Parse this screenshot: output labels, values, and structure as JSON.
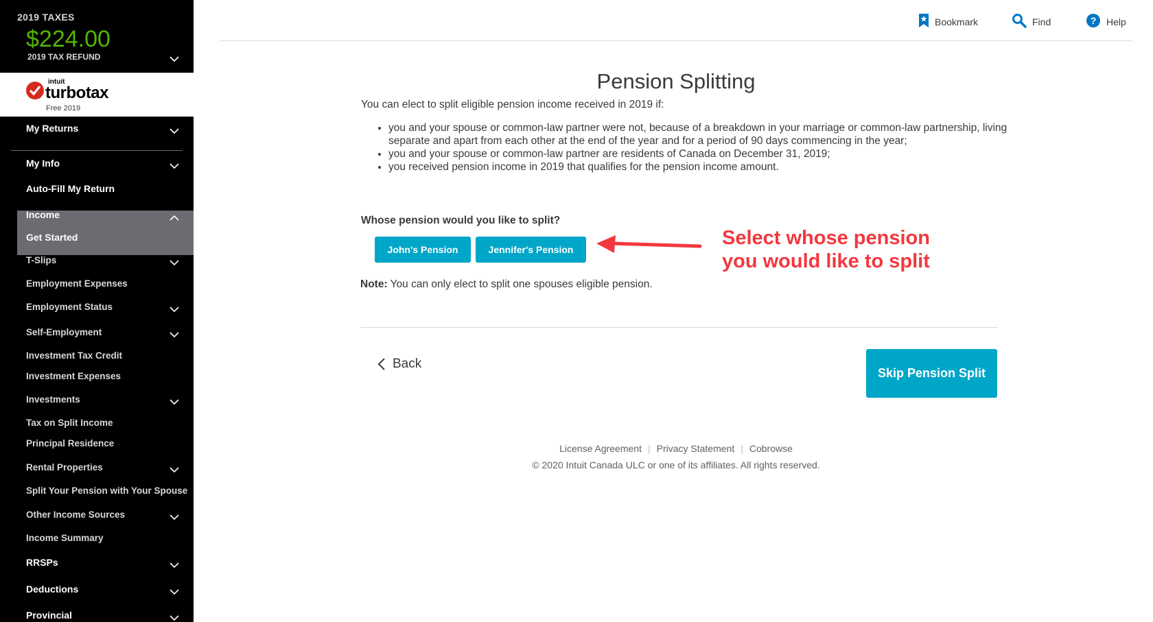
{
  "refund": {
    "title": "2019 TAXES",
    "amount": "$224.00",
    "label": "2019 TAX REFUND"
  },
  "logo": {
    "intuit": "intuit",
    "brand": "turbotax",
    "edition": "Free 2019"
  },
  "sidebar": {
    "my_returns": "My Returns",
    "my_info": "My Info",
    "auto_fill": "Auto-Fill My Return",
    "income": "Income",
    "get_started": "Get Started",
    "items": [
      "T-Slips",
      "Employment Expenses",
      "Employment Status",
      "Self-Employment",
      "Investment Tax Credit",
      "Investment Expenses",
      "Investments",
      "Tax on Split Income",
      "Principal Residence",
      "Rental Properties",
      "Split Your Pension with Your Spouse",
      "Other Income Sources",
      "Income Summary"
    ],
    "rrsps": "RRSPs",
    "deductions": "Deductions",
    "provincial": "Provincial"
  },
  "toolbar": {
    "bookmark": "Bookmark",
    "find": "Find",
    "help": "Help"
  },
  "main": {
    "title": "Pension Splitting",
    "intro": "You can elect to split eligible pension income received in 2019 if:",
    "criteria": [
      "you and your spouse or common-law partner were not, because of a breakdown in your marriage or common-law partnership, living separate and apart from each other at the end of the year and for a period of 90 days commencing in the year;",
      "you and your spouse or common-law partner are residents of Canada on December 31, 2019;",
      "you received pension income in 2019 that qualifies for the pension income amount."
    ],
    "question": "Whose pension would you like to split?",
    "johns_button": "John's Pension",
    "jennifers_button": "Jennifer's Pension",
    "note_label": "Note:",
    "note_text": " You can only elect to split one spouses eligible pension.",
    "back": "Back",
    "skip_button": "Skip Pension Split"
  },
  "annotation": {
    "line1": "Select whose pension",
    "line2": "you would like to split"
  },
  "footer": {
    "license": "License Agreement",
    "privacy": "Privacy Statement",
    "cobrowse": "Cobrowse",
    "copyright": "© 2020 Intuit Canada ULC or one of its affiliates. All rights reserved."
  },
  "colors": {
    "accent": "#00a6c8",
    "refund_green": "#53b700",
    "callout_red": "#f2383f",
    "sidebar_bg": "#000000"
  }
}
